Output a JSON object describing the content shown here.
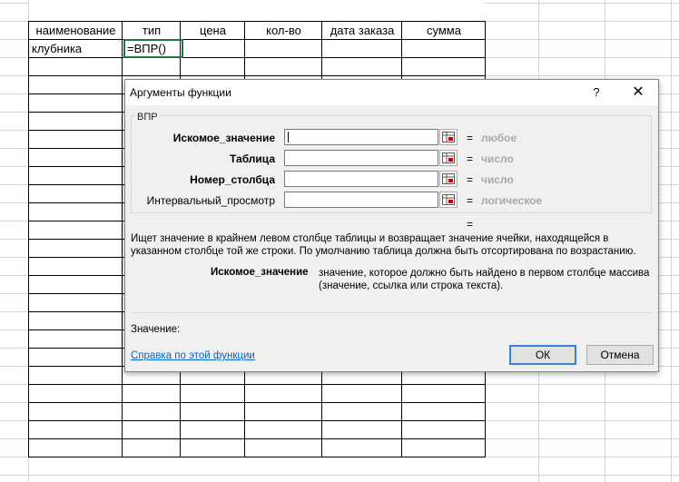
{
  "sheet": {
    "headers": [
      "наименование",
      "тип",
      "цена",
      "кол-во",
      "дата заказа",
      "сумма"
    ],
    "row1": {
      "a": "клубника",
      "b": "=ВПР()"
    }
  },
  "dialog": {
    "title": "Аргументы функции",
    "help_icon": "?",
    "close_icon": "✕",
    "function_name": "ВПР",
    "args": [
      {
        "label": "Искомое_значение",
        "hint": "любое",
        "bold": true
      },
      {
        "label": "Таблица",
        "hint": "число",
        "bold": true
      },
      {
        "label": "Номер_столбца",
        "hint": "число",
        "bold": true
      },
      {
        "label": "Интервальный_просмотр",
        "hint": "логическое",
        "bold": false
      }
    ],
    "equals": "=",
    "description": "Ищет значение в крайнем левом столбце таблицы и возвращает значение ячейки, находящейся в указанном столбце той же строки. По умолчанию таблица должна быть отсортирована по возрастанию.",
    "arg_desc_name": "Искомое_значение",
    "arg_desc_text": "значение, которое должно быть найдено в первом столбце массива (значение, ссылка или строка текста).",
    "value_label": "Значение:",
    "help_link": "Справка по этой функции",
    "ok_label": "ОК",
    "cancel_label": "Отмена",
    "accent_color": "#3c7fd6"
  }
}
